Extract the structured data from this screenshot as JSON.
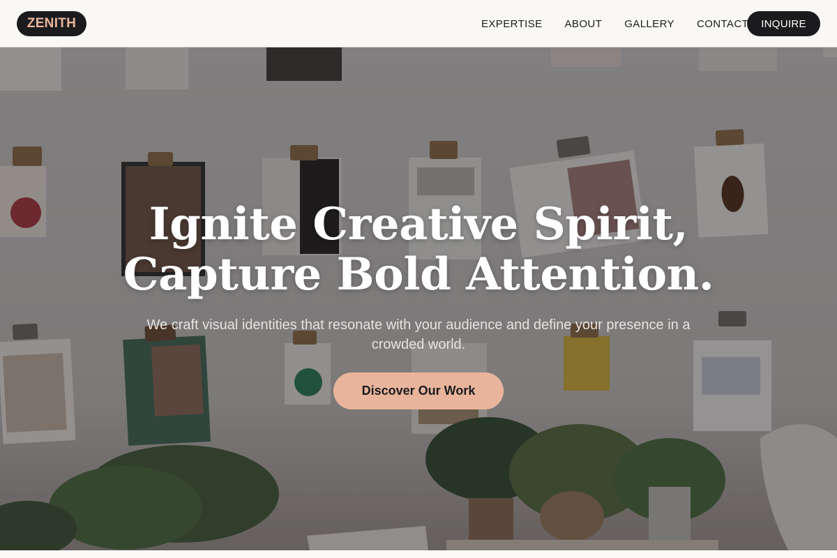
{
  "brand": {
    "name": "ZENITH"
  },
  "nav": {
    "links": [
      "EXPERTISE",
      "ABOUT",
      "GALLERY",
      "CONTACT"
    ],
    "cta_label": "INQUIRE"
  },
  "hero": {
    "headline_line1": "Ignite Creative Spirit,",
    "headline_line2": "Capture Bold Attention.",
    "subtitle": "We craft visual identities that resonate with your audience and define your presence in a crowded world.",
    "cta_label": "Discover Our Work",
    "background": "photo of a white wall with magazines hung on clipboards and potted plants below"
  },
  "colors": {
    "dark": "#1b1b1d",
    "accent": "#e8b59c",
    "nav_bg": "#f9f8f4",
    "headline": "#ffffff"
  }
}
